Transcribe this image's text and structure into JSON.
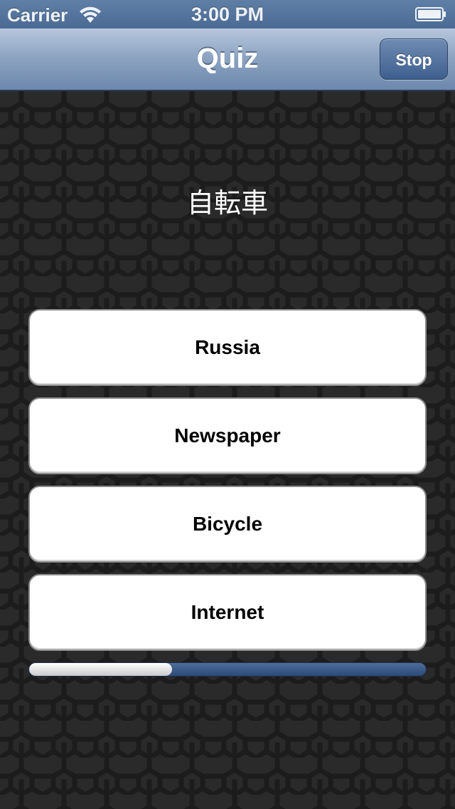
{
  "status_bar": {
    "carrier": "Carrier",
    "time": "3:00 PM",
    "signal_icon": "wifi-icon",
    "battery_icon": "battery-icon"
  },
  "nav": {
    "title": "Quiz",
    "stop_label": "Stop"
  },
  "quiz": {
    "question": "自転車",
    "answers": [
      {
        "label": "Russia"
      },
      {
        "label": "Newspaper"
      },
      {
        "label": "Bicycle"
      },
      {
        "label": "Internet"
      }
    ],
    "progress": 0.36
  },
  "colors": {
    "nav_accent": "#4a6a94",
    "background": "#2a2a2a",
    "progress_track": "#2c4a78"
  }
}
